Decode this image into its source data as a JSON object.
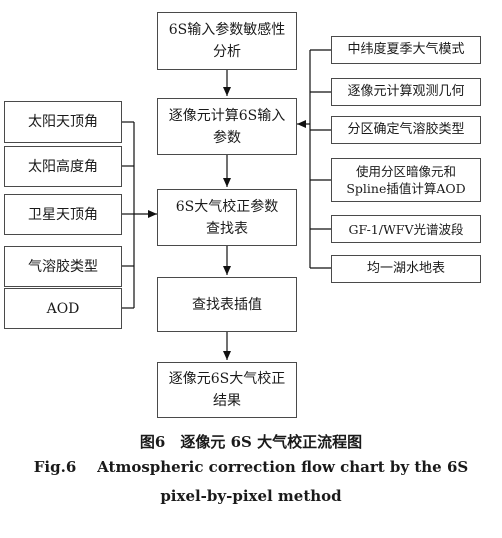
{
  "diagram": {
    "center": {
      "sensitivity": "6S输入参数敏感性\n分析",
      "compute_inputs": "逐像元计算6S输入\n参数",
      "lut": "6S大气校正参数\n查找表",
      "interp": "查找表插值",
      "result": "逐像元6S大气校正\n结果"
    },
    "left": [
      "太阳天顶角",
      "太阳高度角",
      "卫星天顶角",
      "气溶胶类型",
      "AOD"
    ],
    "right": [
      "中纬度夏季大气模式",
      "逐像元计算观测几何",
      "分区确定气溶胶类型",
      "使用分区暗像元和\nSpline插值计算AOD",
      "GF-1/WFV光谱波段",
      "均一湖水地表"
    ]
  },
  "caption": {
    "zh": "图6　逐像元 6S 大气校正流程图",
    "en_line1": "Fig.6    Atmospheric correction flow chart by the 6S",
    "en_line2": "pixel-by-pixel method"
  }
}
